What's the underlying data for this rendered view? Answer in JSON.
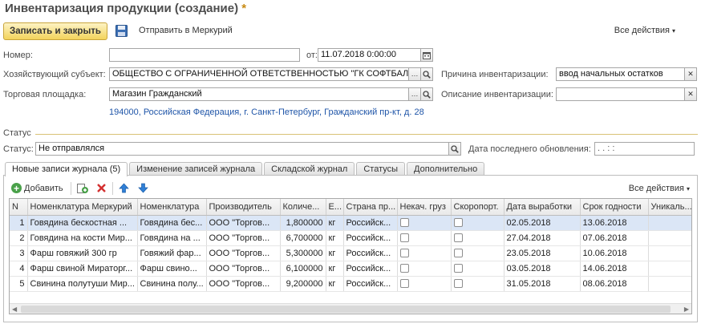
{
  "window": {
    "title": "Инвентаризация продукции (создание)",
    "modified_mark": "*"
  },
  "toolbar": {
    "save_close_label": "Записать и закрыть",
    "send_mercury_label": "Отправить в Меркурий",
    "all_actions_label": "Все действия",
    "all_actions_arrow": "▾"
  },
  "form": {
    "number": {
      "label": "Номер:",
      "value": ""
    },
    "date": {
      "label": "от:",
      "value": "11.07.2018  0:00:00"
    },
    "subject": {
      "label": "Хозяйствующий субъект:",
      "value": "ОБЩЕСТВО С ОГРАНИЧЕННОЙ ОТВЕТСТВЕННОСТЬЮ \"ГК СОФТБАЛА"
    },
    "reason": {
      "label": "Причина инвентаризации:",
      "value": "ввод начальных остатков"
    },
    "venue": {
      "label": "Торговая площадка:",
      "value": "Магазин Гражданский"
    },
    "description": {
      "label": "Описание инвентаризации:",
      "value": ""
    },
    "address_link": "194000, Российская Федерация, г. Санкт-Петербург, Гражданский пр-кт, д. 28"
  },
  "status_section": {
    "heading": "Статус",
    "status_label": "Статус:",
    "status_value": "Не отправлялся",
    "last_update_label": "Дата последнего обновления:",
    "last_update_value": ".   .        :   :"
  },
  "tabs": [
    {
      "label": "Новые записи журнала (5)",
      "active": true
    },
    {
      "label": "Изменение записей журнала",
      "active": false
    },
    {
      "label": "Складской журнал",
      "active": false
    },
    {
      "label": "Статусы",
      "active": false
    },
    {
      "label": "Дополнительно",
      "active": false
    }
  ],
  "table_toolbar": {
    "add_label": "Добавить",
    "all_actions_label": "Все действия",
    "all_actions_arrow": "▾"
  },
  "table": {
    "columns": [
      "N",
      "Номенклатура Меркурий",
      "Номенклатура",
      "Производитель",
      "Количе...",
      "Е...",
      "Страна пр...",
      "Некач. груз",
      "Скоропорт.",
      "Дата выработки",
      "Срок годности",
      "Уникаль..."
    ],
    "rows": [
      {
        "n": "1",
        "merc": "Говядина бескостная ...",
        "nom": "Говядина бес...",
        "maker": "ООО \"Торгов...",
        "qty": "1,800000",
        "unit": "кг",
        "country": "Российск...",
        "defect": false,
        "perish": false,
        "made": "02.05.2018",
        "expiry": "13.06.2018",
        "uniq": "",
        "selected": true
      },
      {
        "n": "2",
        "merc": "Говядина на кости Мир...",
        "nom": "Говядина на ...",
        "maker": "ООО \"Торгов...",
        "qty": "6,700000",
        "unit": "кг",
        "country": "Российск...",
        "defect": false,
        "perish": false,
        "made": "27.04.2018",
        "expiry": "07.06.2018",
        "uniq": "",
        "selected": false
      },
      {
        "n": "3",
        "merc": "Фарш говяжий 300 гр",
        "nom": "Говяжий фар...",
        "maker": "ООО \"Торгов...",
        "qty": "5,300000",
        "unit": "кг",
        "country": "Российск...",
        "defect": false,
        "perish": false,
        "made": "23.05.2018",
        "expiry": "10.06.2018",
        "uniq": "",
        "selected": false
      },
      {
        "n": "4",
        "merc": "Фарш свиной Мираторг...",
        "nom": "Фарш свино...",
        "maker": "ООО \"Торгов...",
        "qty": "6,100000",
        "unit": "кг",
        "country": "Российск...",
        "defect": false,
        "perish": false,
        "made": "03.05.2018",
        "expiry": "14.06.2018",
        "uniq": "",
        "selected": false
      },
      {
        "n": "5",
        "merc": "Свинина полутуши Мир...",
        "nom": "Свинина полу...",
        "maker": "ООО \"Торгов...",
        "qty": "9,200000",
        "unit": "кг",
        "country": "Российск...",
        "defect": false,
        "perish": false,
        "made": "31.05.2018",
        "expiry": "08.06.2018",
        "uniq": "",
        "selected": false
      }
    ]
  },
  "icons": {
    "save": "floppy-disk-icon",
    "search": "magnifier-icon",
    "clear": "x-icon",
    "calendar": "calendar-icon",
    "choose": "ellipsis-icon",
    "add": "plus-circle-icon",
    "copy": "copy-add-icon",
    "delete": "red-x-icon",
    "up": "arrow-up-icon",
    "down": "arrow-down-icon"
  },
  "colors": {
    "accent": "#f3d45c",
    "link": "#1f55a8",
    "selection": "#dbe6f6",
    "delete": "#d32f2f",
    "arrows": "#2f7fd6"
  }
}
